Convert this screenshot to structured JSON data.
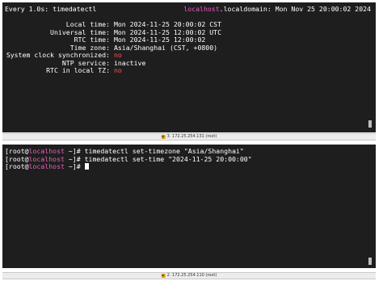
{
  "terminal_top": {
    "header_left": "Every 1.0s: timedatectl",
    "header_host": "localhost",
    "header_rest": ".localdomain: Mon Nov 25 20:00:02 2024",
    "rows": [
      {
        "label": "Local time:",
        "value": "Mon 2024-11-25 20:00:02 CST"
      },
      {
        "label": "Universal time:",
        "value": "Mon 2024-11-25 12:00:02 UTC"
      },
      {
        "label": "RTC time:",
        "value": "Mon 2024-11-25 12:00:02"
      },
      {
        "label": "Time zone:",
        "value": "Asia/Shanghai (CST, +0800)"
      },
      {
        "label": "System clock synchronized:",
        "value": "no"
      },
      {
        "label": "NTP service:",
        "value": "inactive"
      },
      {
        "label": "RTC in local TZ:",
        "value": "no"
      }
    ],
    "status_label": "3. 172.25.254.131 (root)"
  },
  "terminal_bottom": {
    "lines": [
      {
        "prefix": "[root@",
        "host": "localhost",
        "suffix": " ~]# ",
        "command": "timedatectl set-timezone \"Asia/Shanghai\""
      },
      {
        "prefix": "[root@",
        "host": "localhost",
        "suffix": " ~]# ",
        "command": "timedatectl set-time \"2024-11-25 20:00:00\""
      },
      {
        "prefix": "[root@",
        "host": "localhost",
        "suffix": " ~]# ",
        "command": ""
      }
    ],
    "status_label": "2. 172.25.254.110 (root)"
  },
  "colors": {
    "terminal_bg": "#1e1e1e",
    "host_pink": "#e65fbd",
    "value_red": "#ff5252"
  }
}
